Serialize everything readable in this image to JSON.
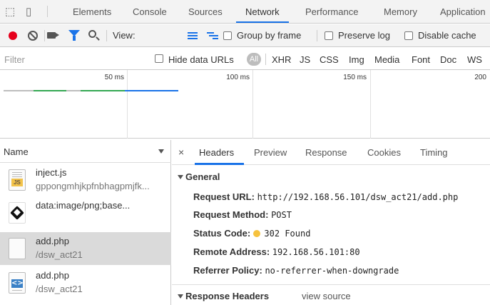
{
  "tabs": [
    {
      "label": "Elements"
    },
    {
      "label": "Console"
    },
    {
      "label": "Sources"
    },
    {
      "label": "Network"
    },
    {
      "label": "Performance"
    },
    {
      "label": "Memory"
    },
    {
      "label": "Application"
    }
  ],
  "active_tab": "Network",
  "toolbar": {
    "view_label": "View:",
    "group_by_frame": "Group by frame",
    "preserve_log": "Preserve log",
    "disable_cache": "Disable cache"
  },
  "filter": {
    "placeholder": "Filter",
    "hide_data_urls": "Hide data URLs",
    "all": "All",
    "types": [
      "XHR",
      "JS",
      "CSS",
      "Img",
      "Media",
      "Font",
      "Doc",
      "WS"
    ]
  },
  "timeline": {
    "labels": [
      "50 ms",
      "100 ms",
      "150 ms",
      "200"
    ]
  },
  "request_list": {
    "column": "Name",
    "items": [
      {
        "name": "inject.js",
        "path": "gppongmhjkpfnbhagpmjfk...",
        "icon": "js-file-icon"
      },
      {
        "name": "data:image/png;base...",
        "path": "",
        "icon": "image-file-icon"
      },
      {
        "name": "add.php",
        "path": "/dsw_act21",
        "icon": "blank-document-icon",
        "selected": true
      },
      {
        "name": "add.php",
        "path": "/dsw_act21",
        "icon": "code-file-icon"
      }
    ]
  },
  "details": {
    "close": "×",
    "tabs": [
      "Headers",
      "Preview",
      "Response",
      "Cookies",
      "Timing"
    ],
    "active_tab": "Headers",
    "general_title": "General",
    "general": [
      {
        "key": "Request URL:",
        "value": "http://192.168.56.101/dsw_act21/add.php"
      },
      {
        "key": "Request Method:",
        "value": "POST"
      },
      {
        "key": "Status Code:",
        "value": "302 Found"
      },
      {
        "key": "Remote Address:",
        "value": "192.168.56.101:80"
      },
      {
        "key": "Referrer Policy:",
        "value": "no-referrer-when-downgrade"
      }
    ],
    "response_headers_title": "Response Headers",
    "view_source": "view source"
  },
  "colors": {
    "accent": "#1a73e8",
    "record": "#e6001c",
    "status_warning": "#f6c23e",
    "timeline_green": "#34a853"
  }
}
